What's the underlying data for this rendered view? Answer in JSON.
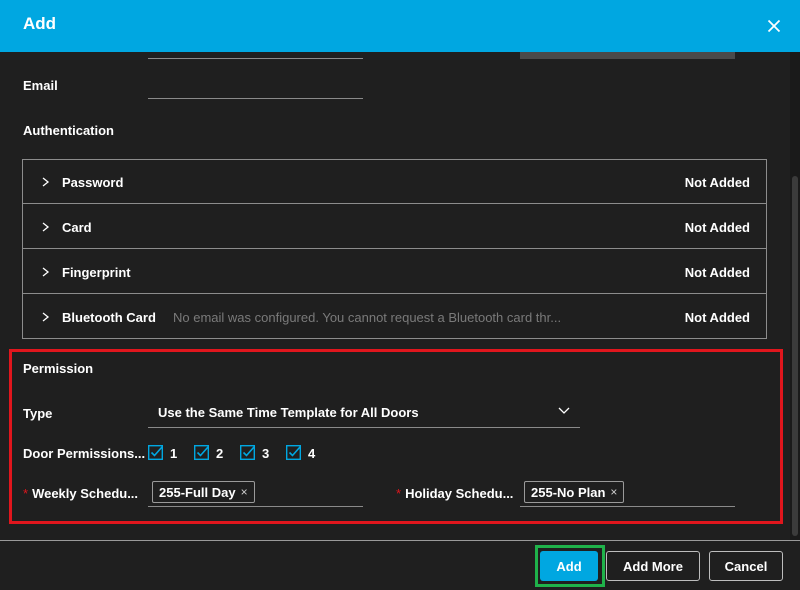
{
  "dialog": {
    "title": "Add"
  },
  "form": {
    "email_label": "Email"
  },
  "authentication": {
    "title": "Authentication",
    "rows": [
      {
        "name": "Password",
        "note": "",
        "status": "Not Added"
      },
      {
        "name": "Card",
        "note": "",
        "status": "Not Added"
      },
      {
        "name": "Fingerprint",
        "note": "",
        "status": "Not Added"
      },
      {
        "name": "Bluetooth Card",
        "note": "No email was configured. You cannot request a Bluetooth card thr...",
        "status": "Not Added"
      }
    ]
  },
  "permission": {
    "title": "Permission",
    "type_label": "Type",
    "type_value": "Use the Same Time Template for All Doors",
    "door_label": "Door Permissions...",
    "doors": [
      "1",
      "2",
      "3",
      "4"
    ],
    "weekly_label": "Weekly Schedu...",
    "weekly_tag": "255-Full Day",
    "holiday_label": "Holiday Schedu...",
    "holiday_tag": "255-No Plan",
    "required_mark": "*",
    "tag_remove": "×"
  },
  "footer": {
    "add": "Add",
    "add_more": "Add More",
    "cancel": "Cancel"
  },
  "colors": {
    "accent": "#00a7e1",
    "highlight_red": "#e0161d",
    "highlight_green": "#1fb24a",
    "background": "#1f1f1f"
  },
  "icons": {
    "close": "close-icon",
    "expand": "chevron-right-icon",
    "dropdown": "chevron-down-icon",
    "checkbox": "checkbox-checked-icon"
  }
}
